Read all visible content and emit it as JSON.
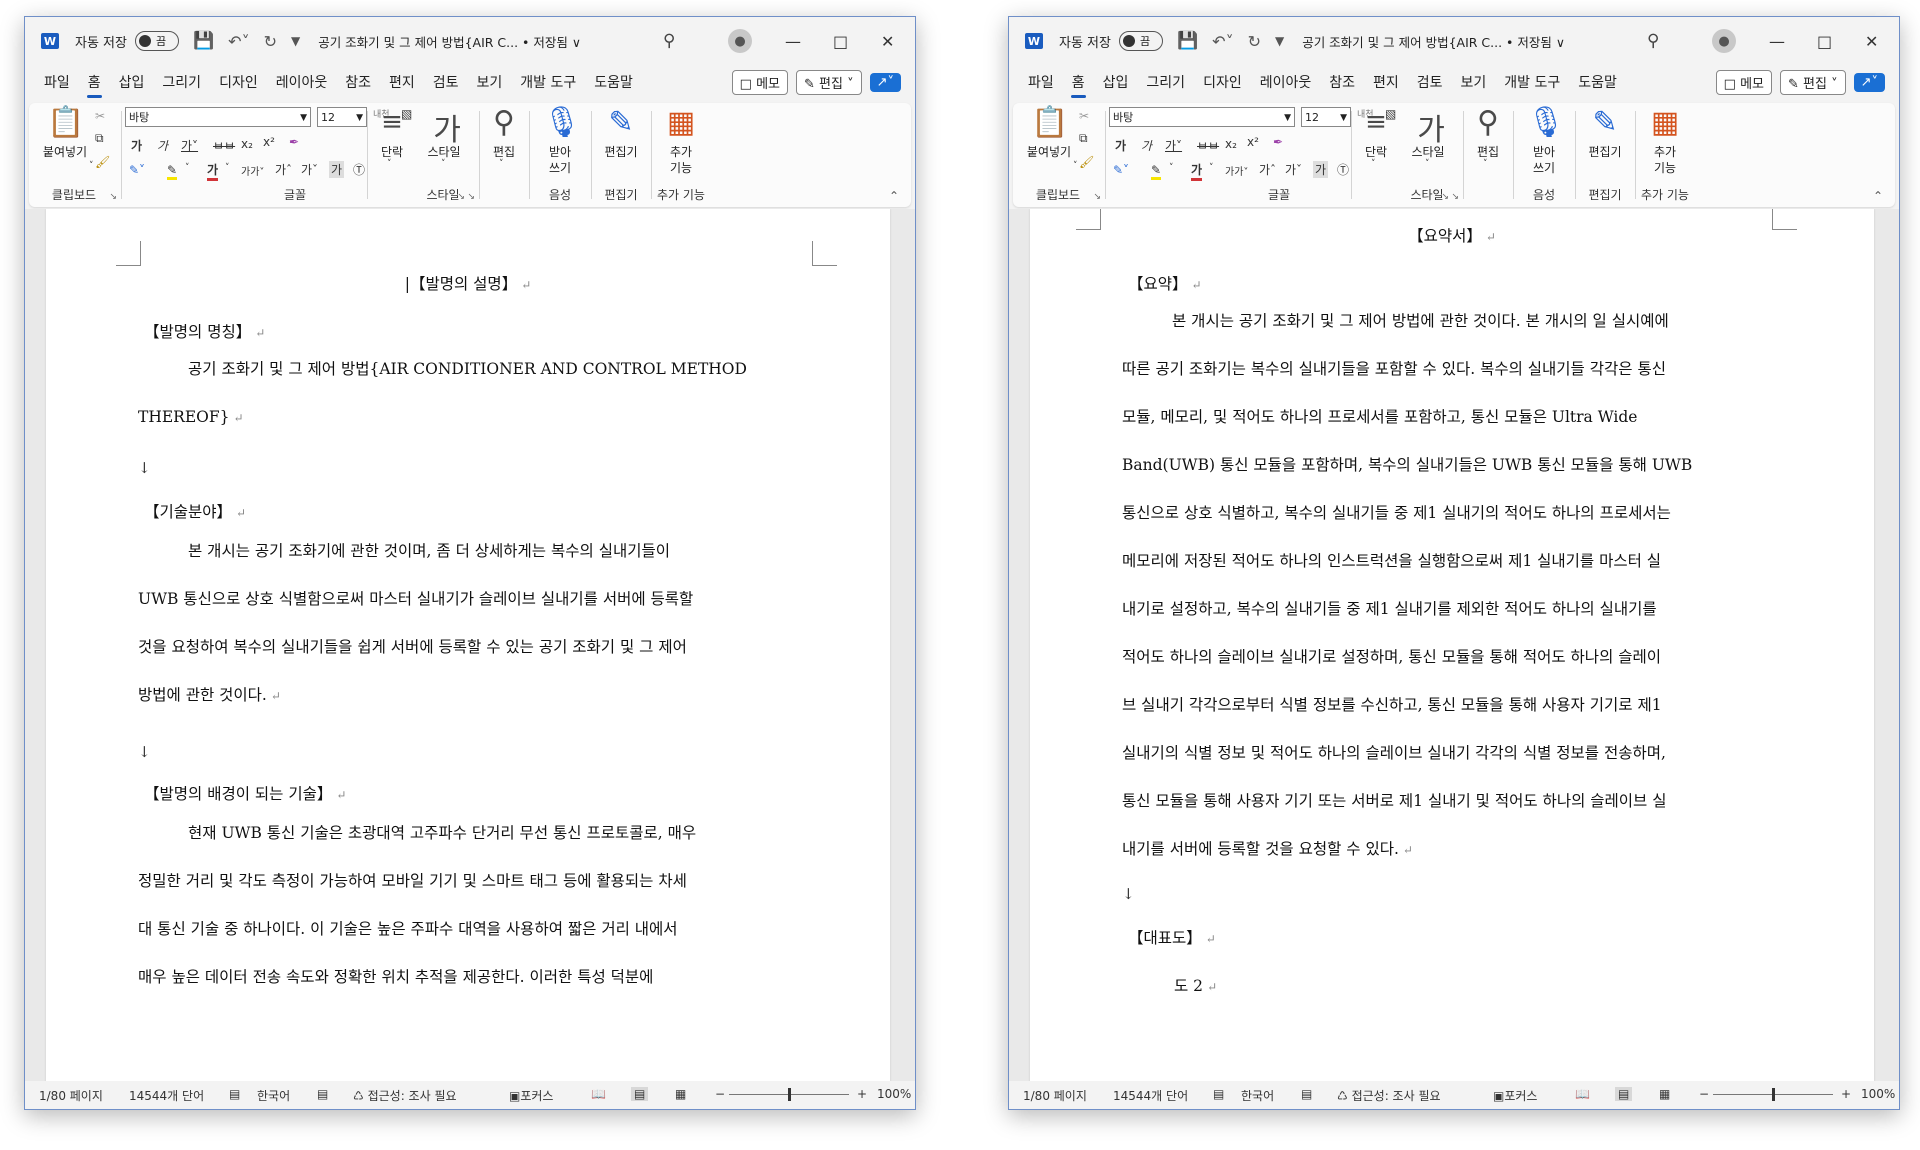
{
  "app": {
    "autosave_label": "자동 저장",
    "autosave_state": "끔",
    "doc_title": "공기 조화기 및 그 제어 방법{AIR C... • 저장됨 ∨",
    "menu_tabs": [
      "파일",
      "홈",
      "삽입",
      "그리기",
      "디자인",
      "레이아웃",
      "참조",
      "편지",
      "검토",
      "보기",
      "개발 도구",
      "도움말"
    ],
    "active_tab": "홈",
    "memo_label": "메모",
    "edit_label": "편집",
    "ribbon": {
      "paste_label": "붙여넣기",
      "clipboard_group": "클립보드",
      "font_name": "바탕",
      "font_size": "12",
      "font_group": "글꼴",
      "paragraph_label": "단락",
      "style_label": "스타일",
      "style_group": "스타일",
      "editing_label": "편집",
      "dictate_label1": "받아",
      "dictate_label2": "쓰기",
      "voice_group": "음성",
      "editor_label": "편집기",
      "editor_group": "편집기",
      "addins_label1": "추가",
      "addins_label2": "기능",
      "addins_group": "추가 기능"
    },
    "status": {
      "page": "1/80 페이지",
      "words": "14544개 단어",
      "language": "한국어",
      "accessibility": "접근성: 조사 필요",
      "focus": "포커스",
      "zoom": "100%",
      "zoom_level": 0.5
    }
  },
  "doc_left": {
    "title": "【발명의 설명】",
    "h1": "【발명의 명칭】",
    "p1a": "공기 조화기 및 그 제어 방법{AIR CONDITIONER AND CONTROL METHOD",
    "p1b": "THEREOF}",
    "h2": "【기술분야】",
    "p2a": "본 개시는 공기 조화기에 관한 것이며, 좀 더 상세하게는 복수의 실내기들이",
    "p2b": "UWB 통신으로 상호 식별함으로써 마스터 실내기가 슬레이브 실내기를 서버에 등록할",
    "p2c": "것을 요청하여 복수의 실내기들을 쉽게 서버에 등록할 수 있는 공기 조화기 및 그 제어",
    "p2d": "방법에 관한 것이다.",
    "h3": "【발명의 배경이 되는 기술】",
    "p3a": "현재 UWB 통신 기술은 초광대역 고주파수 단거리 무선 통신 프로토콜로, 매우",
    "p3b": "정밀한 거리 및 각도 측정이 가능하여 모바일 기기 및 스마트 태그 등에 활용되는 차세",
    "p3c": "대 통신 기술 중 하나이다. 이 기술은 높은 주파수 대역을 사용하여 짧은 거리 내에서",
    "p3d": "매우 높은 데이터 전송 속도와 정확한 위치 추적을 제공한다. 이러한 특성 덕분에"
  },
  "doc_right": {
    "title": "【요약서】",
    "h1": "【요약】",
    "lines": [
      "본 개시는 공기 조화기 및 그 제어 방법에 관한 것이다. 본 개시의 일 실시예에",
      "따른 공기 조화기는 복수의 실내기들을 포함할 수 있다. 복수의 실내기들 각각은 통신",
      "모듈, 메모리, 및 적어도 하나의 프로세서를 포함하고, 통신 모듈은 Ultra Wide",
      "Band(UWB) 통신 모듈을 포함하며, 복수의 실내기들은 UWB 통신 모듈을 통해 UWB",
      "통신으로 상호 식별하고, 복수의 실내기들 중 제1 실내기의 적어도 하나의 프로세서는",
      "메모리에 저장된 적어도 하나의 인스트럭션을 실행함으로써 제1 실내기를 마스터 실",
      "내기로 설정하고, 복수의 실내기들 중 제1 실내기를 제외한 적어도 하나의 실내기를",
      "적어도 하나의 슬레이브 실내기로 설정하며, 통신 모듈을 통해 적어도 하나의 슬레이",
      "브 실내기 각각으로부터 식별 정보를 수신하고, 통신 모듈을 통해 사용자 기기로 제1",
      "실내기의 식별 정보 및 적어도 하나의 슬레이브 실내기 각각의 식별 정보를 전송하며,",
      "통신 모듈을 통해 사용자 기기 또는 서버로 제1 실내기 및 적어도 하나의 슬레이브 실",
      "내기를 서버에 등록할 것을 요청할 수 있다."
    ],
    "h2": "【대표도】",
    "rep": "도 2"
  }
}
